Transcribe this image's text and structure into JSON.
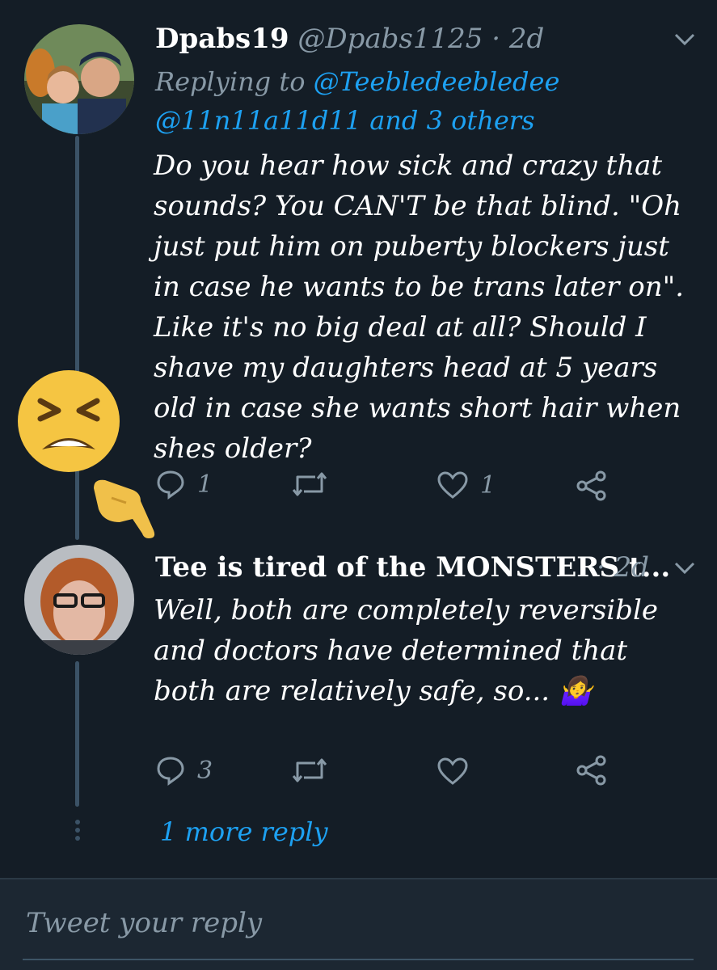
{
  "tweet1": {
    "display_name": "Dpabs19",
    "handle": "@Dpabs1125",
    "time": "· 2d",
    "replying_prefix": "Replying to",
    "replying_handle1": "@Teebledeebledee",
    "replying_line2": "@11n11a11d11 and 3 others",
    "text": "Do you hear how sick and crazy that sounds? You CAN'T be that blind. \"Oh just put him on puberty blockers just in case he wants to be trans later on\". Like it's no big deal at all? Should I shave my daughters head at 5 years old in case she wants short hair when shes older?",
    "reply_count": "1",
    "retweet_count": "",
    "like_count": "1"
  },
  "tweet2": {
    "display_name": "Tee is tired of the MONSTERS t...",
    "time": "· 2d",
    "text": "Well, both are completely reversible and doctors have determined that both are relatively safe, so... 🤷‍♀️",
    "reply_count": "3",
    "retweet_count": "",
    "like_count": ""
  },
  "more_replies": "1 more reply",
  "reply_box": {
    "placeholder": "Tweet your reply"
  },
  "icons": {
    "reply": "reply-icon",
    "retweet": "retweet-icon",
    "like": "heart-icon",
    "share": "share-icon",
    "caret": "chevron-down-icon",
    "persevering_face": "persevering-face-emoji",
    "pointing_hand": "pointing-hand-emoji"
  },
  "colors": {
    "background": "#141d26",
    "link": "#1da1f2",
    "muted": "#8899a6",
    "thread_line": "#3b5266"
  }
}
